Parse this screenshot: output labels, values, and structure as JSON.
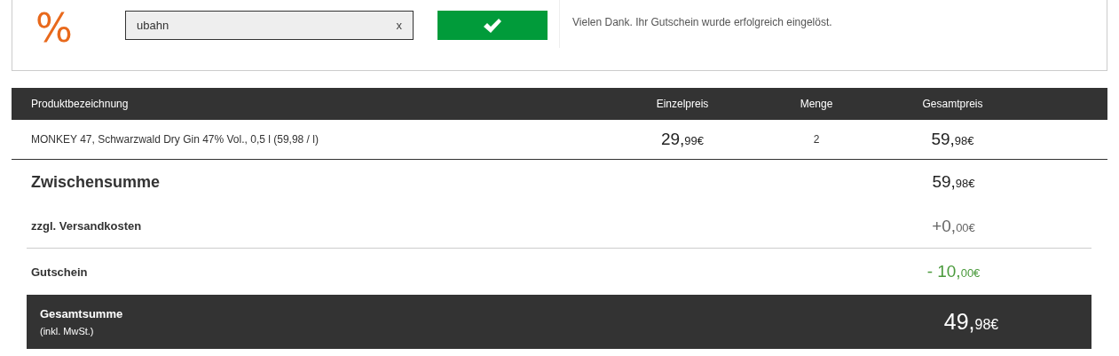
{
  "voucher": {
    "icon": "%",
    "field": {
      "value": "ubahn",
      "clear": "x"
    },
    "message": "Vielen Dank. Ihr Gutschein wurde erfolgreich eingelöst."
  },
  "table": {
    "columns": [
      "Produktbezeichnung",
      "Einzelpreis",
      "Menge",
      "Gesamtpreis"
    ],
    "rows": [
      {
        "name": "MONKEY 47, Schwarzwald Dry Gin 47% Vol., 0,5 l (59,98 / l)",
        "unit_price": {
          "whole": "29,",
          "cents": "99€"
        },
        "quantity": "2",
        "total": {
          "whole": "59,",
          "cents": "98€"
        }
      }
    ]
  },
  "summary": [
    {
      "kind": "subtotal",
      "label": "Zwischensumme",
      "amount": {
        "whole": "59,",
        "cents": "98€"
      }
    },
    {
      "kind": "shipping",
      "label": "zzgl. Versandkosten",
      "amount": {
        "whole": "+0,",
        "cents": "00€"
      }
    },
    {
      "kind": "discount",
      "label": "Gutschein",
      "amount": {
        "whole": "- 10,",
        "cents": "00€"
      }
    }
  ],
  "grand_total": {
    "label": "Gesamtsumme",
    "note": "(inkl. MwSt.)",
    "amount": {
      "whole": "49,",
      "cents": "98€"
    }
  }
}
